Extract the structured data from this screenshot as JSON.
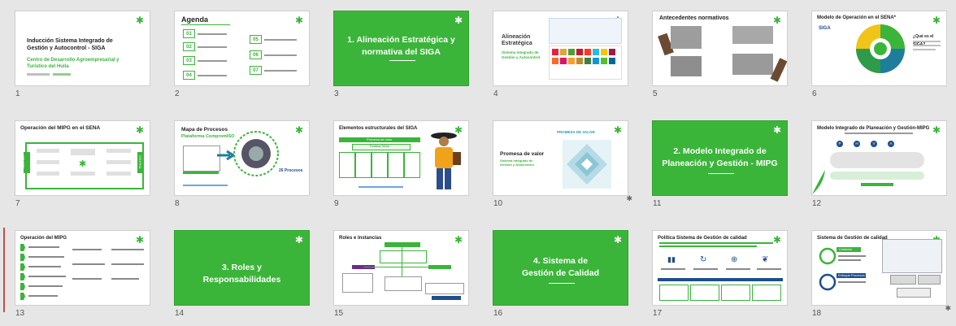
{
  "slides": [
    {
      "number": "1",
      "title": "Inducción Sistema Integrado de Gestión y Autocontrol - SIGA",
      "subtitle": "Centro de Desarrollo Agroempresarial y Turístico del Huila"
    },
    {
      "number": "2",
      "title": "Agenda",
      "items": [
        "01",
        "02",
        "03",
        "04",
        "05",
        "06",
        "07"
      ]
    },
    {
      "number": "3",
      "title": "1. Alineación Estratégica y normativa del SIGA"
    },
    {
      "number": "4",
      "title": "Alineación Estratégica",
      "subtitle": "Sistema Integrado de Gestión y Autocontrol"
    },
    {
      "number": "5",
      "title": "Antecedentes normativos"
    },
    {
      "number": "6",
      "title": "Modelo de Operación en el SENA*",
      "question": "¿Qué es el SIGA?",
      "logo": "SIGA"
    },
    {
      "number": "7",
      "title": "Operación del MIPG en el SENA",
      "side_left": "GESTIÓN",
      "side_right": "CONTROL"
    },
    {
      "number": "8",
      "title": "Mapa de Procesos",
      "subtitle": "Plataforma CompromISO",
      "count": "26 Procesos"
    },
    {
      "number": "9",
      "title": "Elementos estructurales del SIGA",
      "header": "Promesa de valor",
      "subheader": "Política SIGA"
    },
    {
      "number": "10",
      "title": "Promesa de valor",
      "subtitle": "Sistema Integrado de Gestión y Autocontrol",
      "header": "PROMESA DE VALOR"
    },
    {
      "number": "11",
      "title": "2. Modelo Integrado de Planeación y Gestión - MIPG"
    },
    {
      "number": "12",
      "title": "Modelo Integrado de Planeación y Gestión-MIPG",
      "letters": [
        "P",
        "H",
        "V",
        "A"
      ]
    },
    {
      "number": "13",
      "title": "Operación del MIPG"
    },
    {
      "number": "14",
      "title": "3. Roles y Responsabilidades"
    },
    {
      "number": "15",
      "title": "Roles e Instancias"
    },
    {
      "number": "16",
      "title": "4. Sistema de Gestión de Calidad"
    },
    {
      "number": "17",
      "title": "Política Sistema de Gestión de calidad"
    },
    {
      "number": "18",
      "title": "Sistema de Gestión de calidad",
      "labels": [
        "Contexto",
        "Enfoque Procesos"
      ]
    }
  ],
  "icons": {
    "corner": "sena-logo-icon",
    "animation": "animation-star-icon"
  },
  "colors": {
    "brand_green": "#3bb43a",
    "background": "#e6e6e6"
  }
}
